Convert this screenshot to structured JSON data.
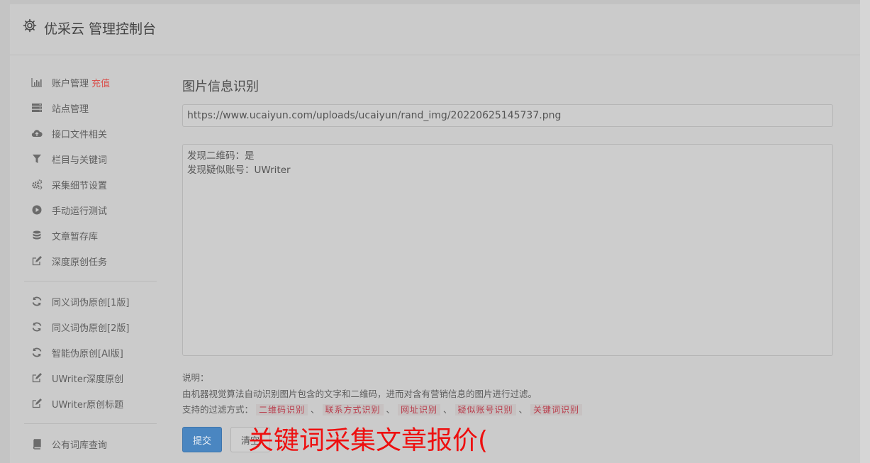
{
  "header": {
    "title": "优采云 管理控制台",
    "icon": "gear-icon"
  },
  "sidebar": {
    "items": [
      {
        "label": "账户管理",
        "badge": "充值",
        "icon": "bar-chart-icon"
      },
      {
        "label": "站点管理",
        "icon": "server-icon"
      },
      {
        "label": "接口文件相关",
        "icon": "cloud-upload-icon"
      },
      {
        "label": "栏目与关键词",
        "icon": "filter-icon"
      },
      {
        "label": "采集细节设置",
        "icon": "gears-icon"
      },
      {
        "label": "手动运行测试",
        "icon": "play-circle-icon"
      },
      {
        "label": "文章暂存库",
        "icon": "database-icon"
      },
      {
        "label": "深度原创任务",
        "icon": "edit-icon"
      },
      {
        "label": "同义词伪原创[1版]",
        "icon": "refresh-icon"
      },
      {
        "label": "同义词伪原创[2版]",
        "icon": "refresh-icon"
      },
      {
        "label": "智能伪原创[AI版]",
        "icon": "refresh-icon"
      },
      {
        "label": "UWriter深度原创",
        "icon": "edit-icon"
      },
      {
        "label": "UWriter原创标题",
        "icon": "edit-icon"
      },
      {
        "label": "公有词库查询",
        "icon": "book-icon"
      }
    ]
  },
  "main": {
    "title": "图片信息识别",
    "url_value": "https://www.ucaiyun.com/uploads/ucaiyun/rand_img/20220625145737.png",
    "result_lines": [
      "发现二维码：是",
      "发现疑似账号：UWriter"
    ],
    "note_label": "说明：",
    "note_desc": "由机器视觉算法自动识别图片包含的文字和二维码，进而对含有营销信息的图片进行过滤。",
    "filter_label": "支持的过滤方式：",
    "filters": [
      "二维码识别",
      "联系方式识别",
      "网址识别",
      "疑似账号识别",
      "关键词识别"
    ],
    "separator": "、",
    "submit_label": "提交",
    "clear_label": "清空"
  },
  "overlay_text": "关键词采集文章报价(",
  "colors": {
    "primary": "#4a86c1",
    "danger": "#d9534f",
    "overlay": "#ee0f0f",
    "tag_text": "#b93b4a"
  }
}
